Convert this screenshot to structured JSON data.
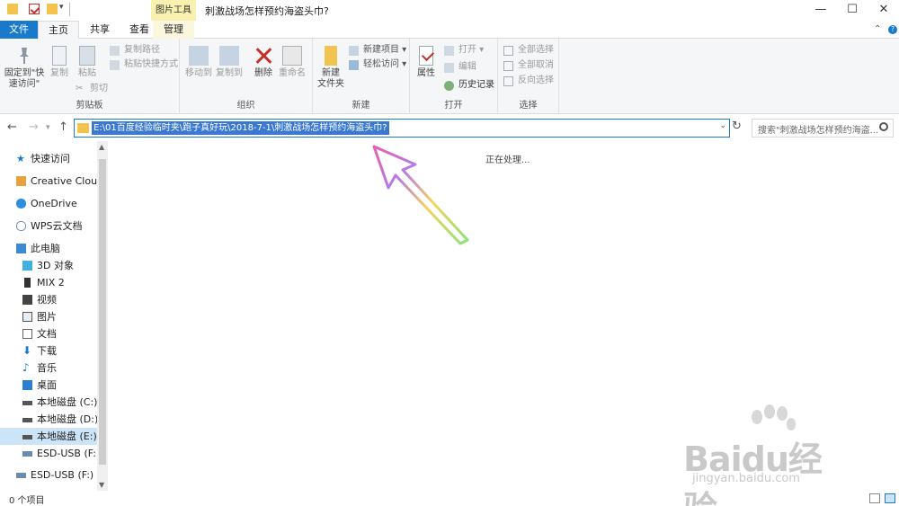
{
  "titlebar": {
    "context_tool": "图片工具",
    "title": "刺激战场怎样预约海盗头巾?"
  },
  "tabs": {
    "file": "文件",
    "home": "主页",
    "share": "共享",
    "view": "查看",
    "manage": "管理"
  },
  "ribbon": {
    "clipboard": {
      "pin_label": "固定到\"快速访问\"",
      "copy": "复制",
      "paste": "粘贴",
      "copy_path": "复制路径",
      "paste_shortcut": "粘贴快捷方式",
      "cut": "剪切",
      "group_label": "剪贴板"
    },
    "organize": {
      "move_to": "移动到",
      "copy_to": "复制到",
      "delete": "删除",
      "rename": "重命名",
      "group_label": "组织"
    },
    "new": {
      "new_folder": "新建\n文件夹",
      "new_item": "新建项目",
      "easy_access": "轻松访问",
      "group_label": "新建"
    },
    "open": {
      "properties": "属性",
      "open": "打开",
      "edit": "编辑",
      "history": "历史记录",
      "group_label": "打开"
    },
    "select": {
      "select_all": "全部选择",
      "select_none": "全部取消",
      "invert": "反向选择",
      "group_label": "选择"
    }
  },
  "address": {
    "path": "E:\\01百度经验临时夹\\跑子真好玩\\2018-7-1\\刺激战场怎样预约海盗头巾?",
    "search_placeholder": "搜索\"刺激战场怎样预约海盗..."
  },
  "sidebar": {
    "items": [
      {
        "label": "快速访问",
        "icon": "star-icon"
      },
      {
        "label": "Creative Cloud F",
        "icon": "creative-cloud-icon"
      },
      {
        "label": "OneDrive",
        "icon": "cloud-icon"
      },
      {
        "label": "WPS云文档",
        "icon": "wps-cloud-icon"
      },
      {
        "label": "此电脑",
        "icon": "computer-icon"
      },
      {
        "label": "3D 对象",
        "icon": "cube-icon"
      },
      {
        "label": "MIX 2",
        "icon": "phone-icon"
      },
      {
        "label": "视频",
        "icon": "video-icon"
      },
      {
        "label": "图片",
        "icon": "picture-icon"
      },
      {
        "label": "文档",
        "icon": "document-icon"
      },
      {
        "label": "下载",
        "icon": "download-icon"
      },
      {
        "label": "音乐",
        "icon": "music-icon"
      },
      {
        "label": "桌面",
        "icon": "desktop-icon"
      },
      {
        "label": "本地磁盘 (C:)",
        "icon": "drive-icon"
      },
      {
        "label": "本地磁盘 (D:)",
        "icon": "drive-icon"
      },
      {
        "label": "本地磁盘 (E:)",
        "icon": "drive-icon"
      },
      {
        "label": "ESD-USB (F:)",
        "icon": "usb-drive-icon"
      },
      {
        "label": "ESD-USB (F:)",
        "icon": "usb-drive-icon"
      }
    ]
  },
  "content": {
    "processing": "正在处理..."
  },
  "status": {
    "count": "0 个项目"
  },
  "watermark": {
    "brand": "Baidu经验",
    "url": "jingyan.baidu.com"
  }
}
